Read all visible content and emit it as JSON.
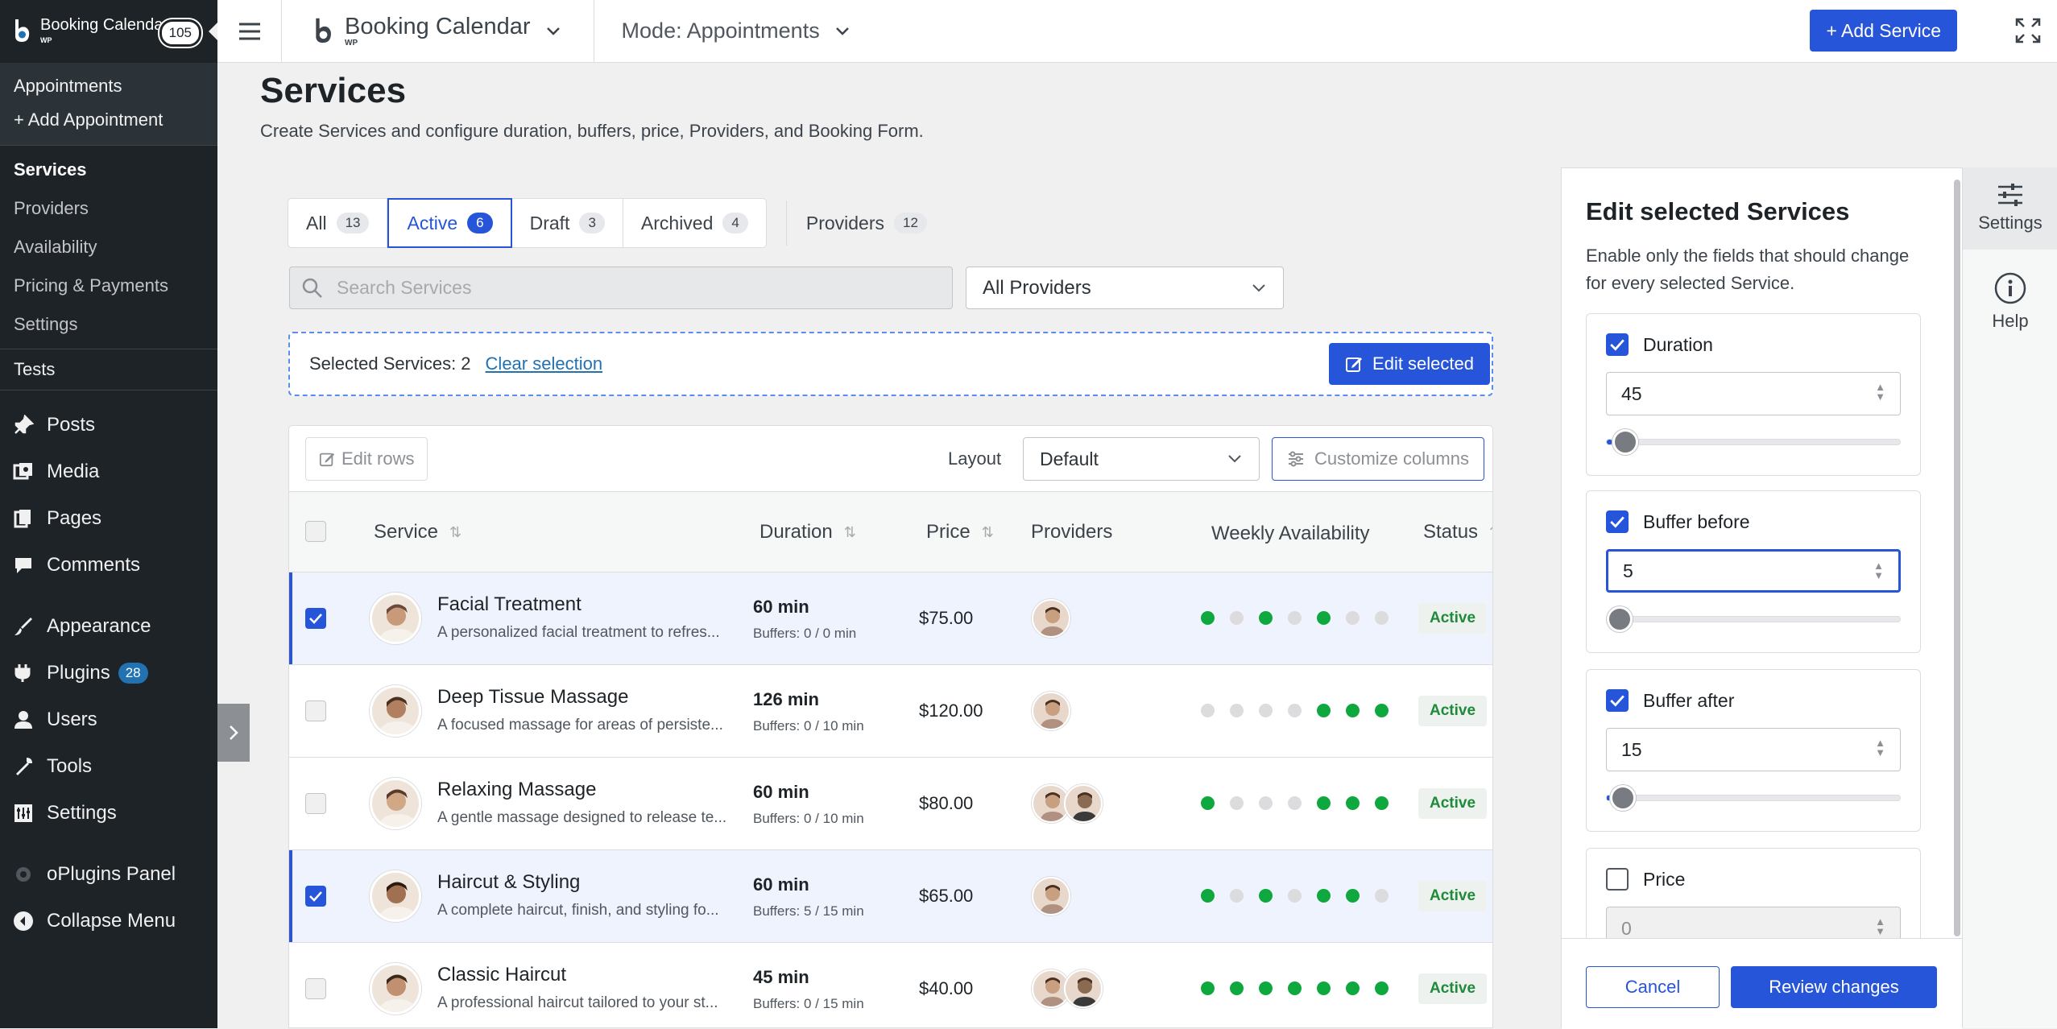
{
  "sidebar": {
    "plugin_title": "Booking Calendar",
    "plugin_sub": "WP",
    "notif_count": "105",
    "submenu": [
      "Appointments",
      "+ Add Appointment"
    ],
    "submenu2": [
      {
        "label": "Services",
        "current": true
      },
      {
        "label": "Providers"
      },
      {
        "label": "Availability"
      },
      {
        "label": "Pricing & Payments"
      },
      {
        "label": "Settings"
      }
    ],
    "tests": "Tests",
    "menu": [
      {
        "label": "Posts",
        "icon": "pin-icon"
      },
      {
        "label": "Media",
        "icon": "media-icon"
      },
      {
        "label": "Pages",
        "icon": "pages-icon"
      },
      {
        "label": "Comments",
        "icon": "comments-icon"
      },
      {
        "label": "Appearance",
        "icon": "brush-icon"
      },
      {
        "label": "Plugins",
        "icon": "plugin-icon",
        "badge": "28"
      },
      {
        "label": "Users",
        "icon": "users-icon"
      },
      {
        "label": "Tools",
        "icon": "wrench-icon"
      },
      {
        "label": "Settings",
        "icon": "settings-icon"
      },
      {
        "label": "oPlugins Panel",
        "icon": "oplugins-icon"
      },
      {
        "label": "Collapse Menu",
        "icon": "collapse-icon"
      }
    ]
  },
  "topbar": {
    "brand": "Booking Calendar",
    "brand_sub": "WP",
    "mode": "Mode: Appointments",
    "add_service": "+ Add Service"
  },
  "page": {
    "title": "Services",
    "subtitle": "Create Services and configure duration, buffers, price, Providers, and Booking Form."
  },
  "tabs": [
    {
      "label": "All",
      "count": "13"
    },
    {
      "label": "Active",
      "count": "6",
      "active": true
    },
    {
      "label": "Draft",
      "count": "3"
    },
    {
      "label": "Archived",
      "count": "4"
    }
  ],
  "providers_tab": {
    "label": "Providers",
    "count": "12"
  },
  "search": {
    "placeholder": "Search Services"
  },
  "provider_filter": "All Providers",
  "selection": {
    "label": "Selected Services: 2",
    "clear": "Clear selection",
    "edit": "Edit selected"
  },
  "toolbar": {
    "edit_rows": "Edit rows",
    "layout_label": "Layout",
    "layout_value": "Default",
    "customize": "Customize columns"
  },
  "columns": {
    "service": "Service",
    "duration": "Duration",
    "price": "Price",
    "providers": "Providers",
    "weekly": "Weekly Availability",
    "status": "Status"
  },
  "rows": [
    {
      "name": "Facial Treatment",
      "desc": "A personalized facial treatment to refres...",
      "duration": "60 min",
      "buffers": "Buffers: 0 / 0 min",
      "price": "$75.00",
      "providers": 1,
      "days": [
        1,
        0,
        1,
        0,
        1,
        0,
        0
      ],
      "status": "Active",
      "selected": true
    },
    {
      "name": "Deep Tissue Massage",
      "desc": "A focused massage for areas of persiste...",
      "duration": "126 min",
      "buffers": "Buffers: 0 / 10 min",
      "price": "$120.00",
      "providers": 1,
      "days": [
        0,
        0,
        0,
        0,
        1,
        1,
        1
      ],
      "status": "Active",
      "selected": false
    },
    {
      "name": "Relaxing Massage",
      "desc": "A gentle massage designed to release te...",
      "duration": "60 min",
      "buffers": "Buffers: 0 / 10 min",
      "price": "$80.00",
      "providers": 2,
      "days": [
        1,
        0,
        0,
        0,
        1,
        1,
        1
      ],
      "status": "Active",
      "selected": false
    },
    {
      "name": "Haircut & Styling",
      "desc": "A complete haircut, finish, and styling fo...",
      "duration": "60 min",
      "buffers": "Buffers: 5 / 15 min",
      "price": "$65.00",
      "providers": 1,
      "days": [
        1,
        0,
        1,
        0,
        1,
        1,
        0
      ],
      "status": "Active",
      "selected": true
    },
    {
      "name": "Classic Haircut",
      "desc": "A professional haircut tailored to your st...",
      "duration": "45 min",
      "buffers": "Buffers: 0 / 15 min",
      "price": "$40.00",
      "providers": 2,
      "days": [
        1,
        1,
        1,
        1,
        1,
        1,
        1
      ],
      "status": "Active",
      "selected": false
    }
  ],
  "panel": {
    "title": "Edit selected Services",
    "desc": "Enable only the fields that should change for every selected Service.",
    "fields": [
      {
        "label": "Duration",
        "value": "45",
        "checked": true,
        "slider": 0.02
      },
      {
        "label": "Buffer before",
        "value": "5",
        "checked": true,
        "slider": 0.0,
        "focus": true
      },
      {
        "label": "Buffer after",
        "value": "15",
        "checked": true,
        "slider": 0.01
      },
      {
        "label": "Price",
        "value": "0",
        "checked": false
      }
    ],
    "cancel": "Cancel",
    "review": "Review changes"
  },
  "rail": {
    "settings": "Settings",
    "help": "Help"
  },
  "colors": {
    "accent": "#2755d9",
    "active_green": "#0ea83e",
    "wp_dark": "#1d2327"
  }
}
